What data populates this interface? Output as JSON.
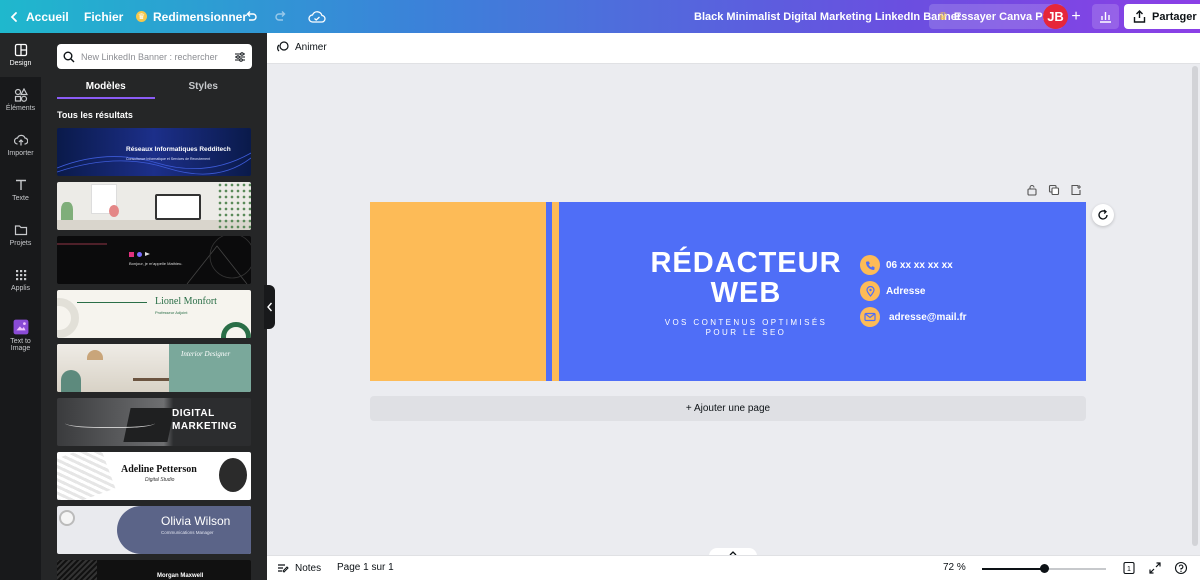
{
  "topbar": {
    "home_label": "Accueil",
    "file_label": "Fichier",
    "resize_label": "Redimensionner",
    "document_title": "Black Minimalist Digital Marketing LinkedIn Banner",
    "pro_label": "Essayer Canva Pro",
    "avatar_initials": "JB",
    "share_label": "Partager"
  },
  "rail": {
    "items": [
      {
        "label": "Design",
        "icon": "design-icon"
      },
      {
        "label": "Éléments",
        "icon": "elements-icon"
      },
      {
        "label": "Importer",
        "icon": "upload-icon"
      },
      {
        "label": "Texte",
        "icon": "text-icon"
      },
      {
        "label": "Projets",
        "icon": "folder-icon"
      },
      {
        "label": "Applis",
        "icon": "apps-icon"
      },
      {
        "label": "Text to Image",
        "icon": "text-to-image-icon"
      }
    ]
  },
  "panel": {
    "search_placeholder": "New LinkedIn Banner : rechercher",
    "tabs": [
      "Modèles",
      "Styles"
    ],
    "results_label": "Tous les résultats",
    "templates": [
      {
        "title": "Réseaux Informatiques Redditech",
        "subtitle": "Consultance Informatique et Services de Recrutement"
      },
      {
        "title": ""
      },
      {
        "title": "Bonjour, je m'appelle Mathieu."
      },
      {
        "title": "Lionel Monfort",
        "subtitle": "Professeur Adjoint"
      },
      {
        "title": "Interior Designer"
      },
      {
        "title": "DIGITAL",
        "subtitle": "MARKETING"
      },
      {
        "title": "Adeline Petterson",
        "subtitle": "Digital Studio"
      },
      {
        "title": "Olivia Wilson",
        "subtitle": "Communications Manager"
      },
      {
        "title": "Morgan Maxwell"
      }
    ]
  },
  "canvas": {
    "animate_label": "Animer",
    "banner": {
      "title_line1": "RÉDACTEUR",
      "title_line2": "WEB",
      "subtitle_line1": "VOS CONTENUS OPTIMISÉS",
      "subtitle_line2": "POUR LE SEO",
      "phone": "06 xx xx xx xx",
      "address": "Adresse",
      "email": "adresse@mail.fr"
    },
    "add_page_label": "+ Ajouter une page"
  },
  "bottombar": {
    "notes_label": "Notes",
    "page_label": "Page 1 sur 1",
    "zoom_label": "72 %",
    "zoom_fraction": 0.5
  },
  "colors": {
    "banner_blue": "#4f6ef7",
    "banner_yellow": "#fdbb57",
    "accent_purple": "#8b5cf6"
  }
}
